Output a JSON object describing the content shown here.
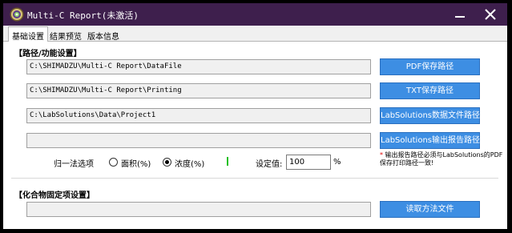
{
  "window": {
    "title": "Multi-C Report(未激活)",
    "minimize_icon": "minimize-icon",
    "close_icon": "close-icon",
    "close_glyph": "✕"
  },
  "tabs": [
    {
      "label": "基础设置",
      "active": true
    },
    {
      "label": "结果预览",
      "active": false
    },
    {
      "label": "版本信息",
      "active": false
    }
  ],
  "path_section": {
    "title": "【路径/功能设置】",
    "rows": [
      {
        "path": "C:\\SHIMADZU\\Multi-C Report\\DataFile",
        "button": "PDF保存路径"
      },
      {
        "path": "C:\\SHIMADZU\\Multi-C Report\\Printing",
        "button": "TXT保存路径"
      },
      {
        "path": "C:\\LabSolutions\\Data\\Project1",
        "button": "LabSolutions数据文件路径"
      },
      {
        "path": "",
        "button": "LabSolutions输出报告路径"
      }
    ]
  },
  "normalize": {
    "label": "归一法选项",
    "options": [
      {
        "label": "面积(%)",
        "checked": false
      },
      {
        "label": "浓度(%)",
        "checked": true
      }
    ],
    "setting_label": "设定值:",
    "setting_value": "100",
    "unit": "%"
  },
  "note": {
    "star": "*",
    "text": "输出报告路径必须与LabSolutions的PDF保存打印路径一致!"
  },
  "compound_section": {
    "title": "【化合物固定项设置】",
    "path": "",
    "button": "读取方法文件"
  },
  "colors": {
    "titlebar": "#3e1f4d",
    "button": "#3d8ee3",
    "accent_green": "#22c022",
    "note_star": "#e00000"
  }
}
